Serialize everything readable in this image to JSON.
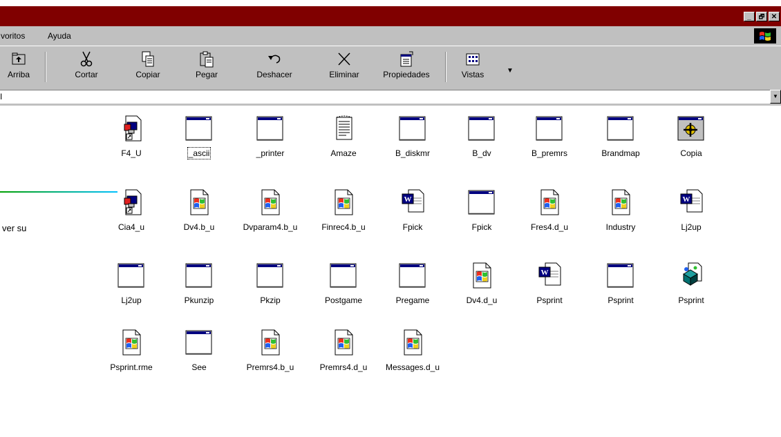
{
  "window": {
    "buttons": [
      "_",
      "🗗",
      "✕"
    ]
  },
  "menu": {
    "items": [
      "voritos",
      "Ayuda"
    ]
  },
  "toolbar": {
    "buttons": [
      {
        "label": "Arriba",
        "icon": "up-folder-icon"
      },
      {
        "label": "Cortar",
        "icon": "scissors-icon"
      },
      {
        "label": "Copiar",
        "icon": "copy-icon"
      },
      {
        "label": "Pegar",
        "icon": "paste-icon"
      },
      {
        "label": "Deshacer",
        "icon": "undo-icon"
      },
      {
        "label": "Eliminar",
        "icon": "delete-x-icon"
      },
      {
        "label": "Propiedades",
        "icon": "properties-icon"
      },
      {
        "label": "Vistas",
        "icon": "views-icon"
      }
    ],
    "views_dropdown": "▼"
  },
  "address": {
    "value": "I",
    "dropdown": "▼"
  },
  "left_panel": {
    "text": "ver su"
  },
  "files": [
    {
      "label": "F4_U",
      "icon": "shortcut-doc-icon"
    },
    {
      "label": "_ascii",
      "icon": "window-app-icon",
      "focused": true
    },
    {
      "label": "_printer",
      "icon": "window-app-icon"
    },
    {
      "label": "Amaze",
      "icon": "notepad-icon"
    },
    {
      "label": "B_diskmr",
      "icon": "window-app-icon"
    },
    {
      "label": "B_dv",
      "icon": "window-app-icon"
    },
    {
      "label": "B_premrs",
      "icon": "window-app-icon"
    },
    {
      "label": "Brandmap",
      "icon": "window-app-icon"
    },
    {
      "label": "Copia",
      "icon": "gear-window-icon"
    },
    {
      "label": "Cia4_u",
      "icon": "shortcut-doc-icon"
    },
    {
      "label": "Dv4.b_u",
      "icon": "windows-doc-icon"
    },
    {
      "label": "Dvparam4.b_u",
      "icon": "windows-doc-icon"
    },
    {
      "label": "Finrec4.b_u",
      "icon": "windows-doc-icon"
    },
    {
      "label": "Fpick",
      "icon": "word-doc-icon"
    },
    {
      "label": "Fpick",
      "icon": "window-app-icon"
    },
    {
      "label": "Fres4.d_u",
      "icon": "windows-doc-icon"
    },
    {
      "label": "Industry",
      "icon": "windows-doc-icon"
    },
    {
      "label": "Lj2up",
      "icon": "word-doc-icon"
    },
    {
      "label": "Lj2up",
      "icon": "window-app-icon"
    },
    {
      "label": "Pkunzip",
      "icon": "window-app-icon"
    },
    {
      "label": "Pkzip",
      "icon": "window-app-icon"
    },
    {
      "label": "Postgame",
      "icon": "window-app-icon"
    },
    {
      "label": "Pregame",
      "icon": "window-app-icon"
    },
    {
      "label": "Dv4.d_u",
      "icon": "windows-doc-icon"
    },
    {
      "label": "Psprint",
      "icon": "word-doc-icon"
    },
    {
      "label": "Psprint",
      "icon": "window-app-icon"
    },
    {
      "label": "Psprint",
      "icon": "system-file-icon"
    },
    {
      "label": "Psprint.rme",
      "icon": "windows-doc-icon"
    },
    {
      "label": "See",
      "icon": "window-app-icon"
    },
    {
      "label": "Premrs4.b_u",
      "icon": "windows-doc-icon"
    },
    {
      "label": "Premrs4.d_u",
      "icon": "windows-doc-icon"
    },
    {
      "label": "Messages.d_u",
      "icon": "windows-doc-icon"
    }
  ],
  "colors": {
    "titlebar": "#800000",
    "chrome": "#c0c0c0",
    "app_window_bar": "#000080"
  }
}
